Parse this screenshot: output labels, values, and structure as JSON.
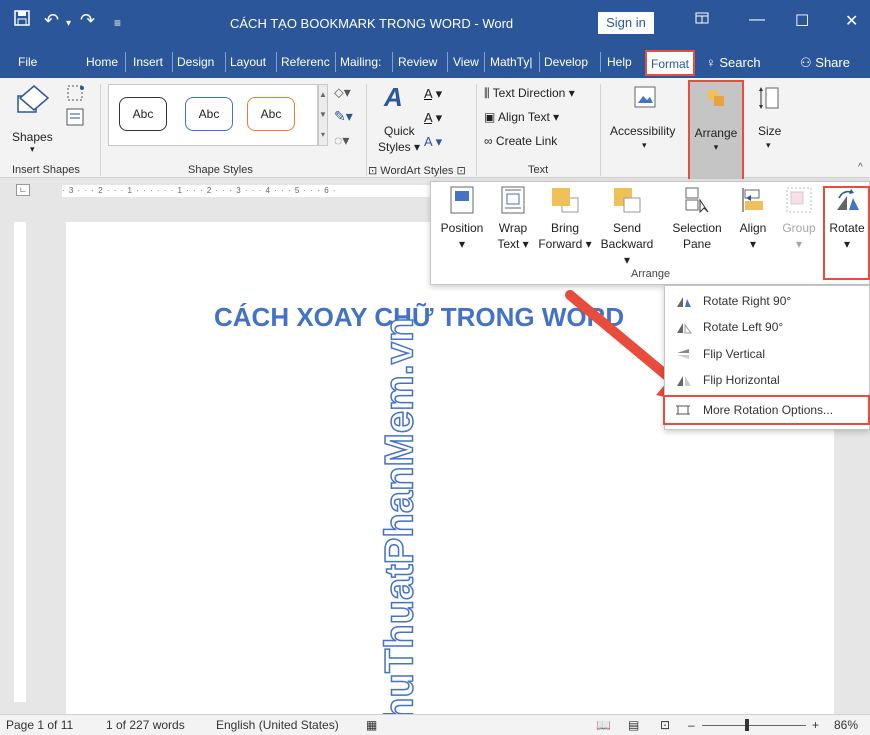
{
  "title_bar": {
    "title": "CÁCH TẠO BOOKMARK TRONG WORD  -  Word",
    "sign_in": "Sign in"
  },
  "tabs": {
    "file": "File",
    "home": "Home",
    "insert": "Insert",
    "design": "Design",
    "layout": "Layout",
    "references": "Referenc",
    "mailings": "Mailing:",
    "review": "Review",
    "view": "View",
    "mathtype": "MathTy|",
    "developer": "Develop",
    "help": "Help",
    "format": "Format",
    "search": "Search",
    "share": "Share"
  },
  "ribbon": {
    "shapes": "Shapes",
    "insert_shapes": "Insert Shapes",
    "abc1": "Abc",
    "abc2": "Abc",
    "abc3": "Abc",
    "shape_styles": "Shape Styles",
    "quick_styles_1": "Quick",
    "quick_styles_2": "Styles",
    "wordart_styles": "WordArt Styles",
    "text_direction": "Text Direction",
    "align_text": "Align Text",
    "create_link": "Create Link",
    "text_group": "Text",
    "accessibility": "Accessibility",
    "arrange": "Arrange",
    "size": "Size"
  },
  "ruler_text": "· 3 · · · 2 · · · 1 · · ·   · · · 1 · · · 2 · · · 3 · · · 4 · · · 5 · · · 6 ·",
  "arrange_panel": {
    "position": "Position",
    "wrap_1": "Wrap",
    "wrap_2": "Text",
    "bring_1": "Bring",
    "bring_2": "Forward",
    "send_1": "Send",
    "send_2": "Backward",
    "selection_1": "Selection",
    "selection_2": "Pane",
    "align": "Align",
    "group": "Group",
    "rotate": "Rotate",
    "group_label": "Arrange"
  },
  "rotate_menu": {
    "rotate_right": "Rotate Right 90°",
    "rotate_left": "Rotate Left 90°",
    "flip_vertical": "Flip Vertical",
    "flip_horizontal": "Flip Horizontal",
    "more_options": "More Rotation Options..."
  },
  "document": {
    "heading": "CÁCH XOAY CHỮ TRONG WORD",
    "vertical_text": "ThuThuatPhanMem.vn"
  },
  "status": {
    "page": "Page 1 of 11",
    "words": "1 of 227 words",
    "language": "English (United States)",
    "zoom": "86%"
  },
  "colors": {
    "word_blue": "#2b579a",
    "heading_blue": "#4472c4",
    "highlight_red": "#e74c3c"
  }
}
